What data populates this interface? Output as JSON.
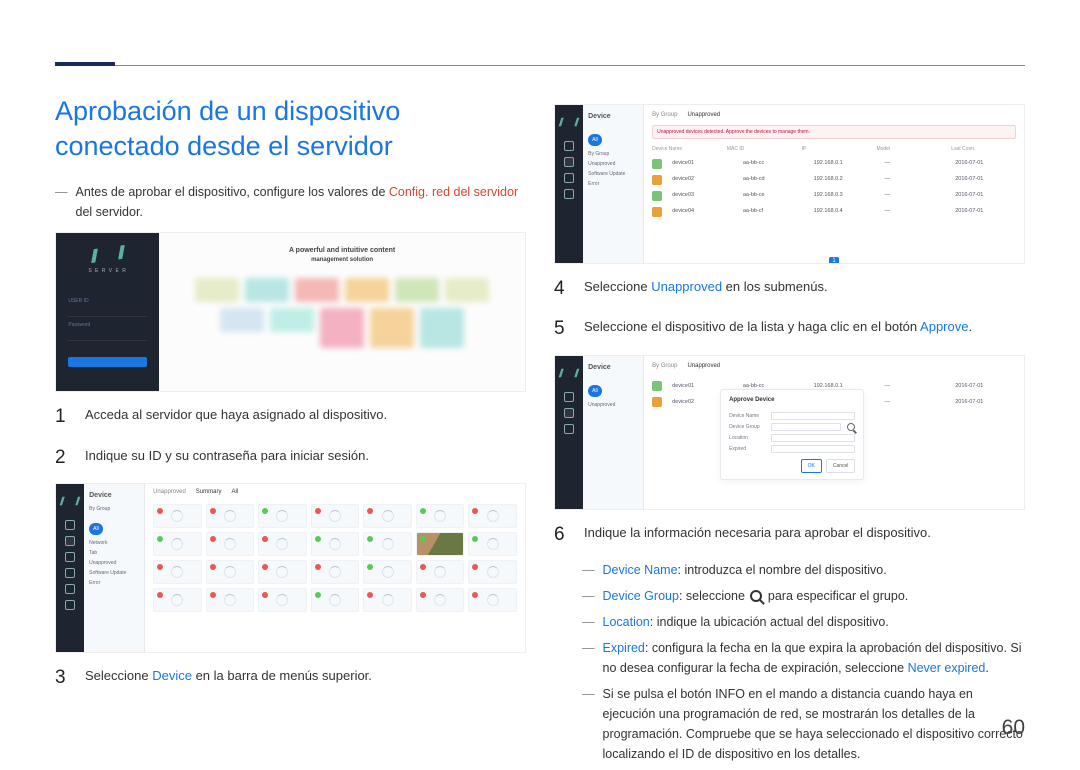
{
  "page_number": "60",
  "title": "Aprobación de un dispositivo conectado desde el servidor",
  "intro_note": {
    "prefix": "Antes de aprobar el dispositivo, configure los valores de ",
    "highlight": "Config. red del servidor",
    "suffix": " del servidor."
  },
  "steps": {
    "1": "Acceda al servidor que haya asignado al dispositivo.",
    "2": "Indique su ID y su contraseña para iniciar sesión.",
    "3_prefix": "Seleccione ",
    "3_link": "Device",
    "3_suffix": " en la barra de menús superior.",
    "4_prefix": "Seleccione ",
    "4_link": "Unapproved",
    "4_suffix": " en los submenús.",
    "5_prefix": "Seleccione el dispositivo de la lista y haga clic en el botón ",
    "5_link": "Approve",
    "5_suffix": ".",
    "6": "Indique la información necesaria para aprobar el dispositivo."
  },
  "sub_notes": {
    "device_name_label": "Device Name",
    "device_name_text": ": introduzca el nombre del dispositivo.",
    "device_group_label": "Device Group",
    "device_group_text_pre": ": seleccione ",
    "device_group_text_post": " para especificar el grupo.",
    "location_label": "Location",
    "location_text": ": indique la ubicación actual del dispositivo.",
    "expired_label": "Expired",
    "expired_text_pre": ": configura la fecha en la que expira la aprobación del dispositivo. Si no desea configurar la fecha de expiración, seleccione ",
    "expired_link": "Never expired",
    "expired_text_post": ".",
    "info_pre": "Si se pulsa el botón ",
    "info_btn": "INFO",
    "info_post": " en el mando a distancia cuando haya en ejecución una programación de red, se mostrarán los detalles de la programación. Compruebe que se haya seleccionado el dispositivo correcto localizando el ID de dispositivo en los detalles."
  },
  "ss1": {
    "server_label": "S E R V E R",
    "id_label": "USER ID",
    "pw_label": "Password",
    "headline1": "A powerful and intuitive content",
    "headline2": "management solution"
  },
  "ss2": {
    "panel_title": "Device",
    "by_group": "By Group",
    "all_pill": "All",
    "tabs": [
      "Unapproved",
      "Summary",
      "All"
    ]
  },
  "ss3": {
    "panel_title": "Device",
    "all_pill": "All",
    "tab_unapproved": "Unapproved",
    "warn": "Unapproved devices detected. Approve the devices to manage them."
  },
  "ss4": {
    "panel_title": "Device",
    "tab_unapproved": "Unapproved",
    "modal_title": "Approve Device",
    "f_device_name": "Device Name",
    "f_device_group": "Device Group",
    "f_location": "Location",
    "f_expired": "Expired",
    "btn_ok": "OK",
    "btn_cancel": "Cancel"
  }
}
